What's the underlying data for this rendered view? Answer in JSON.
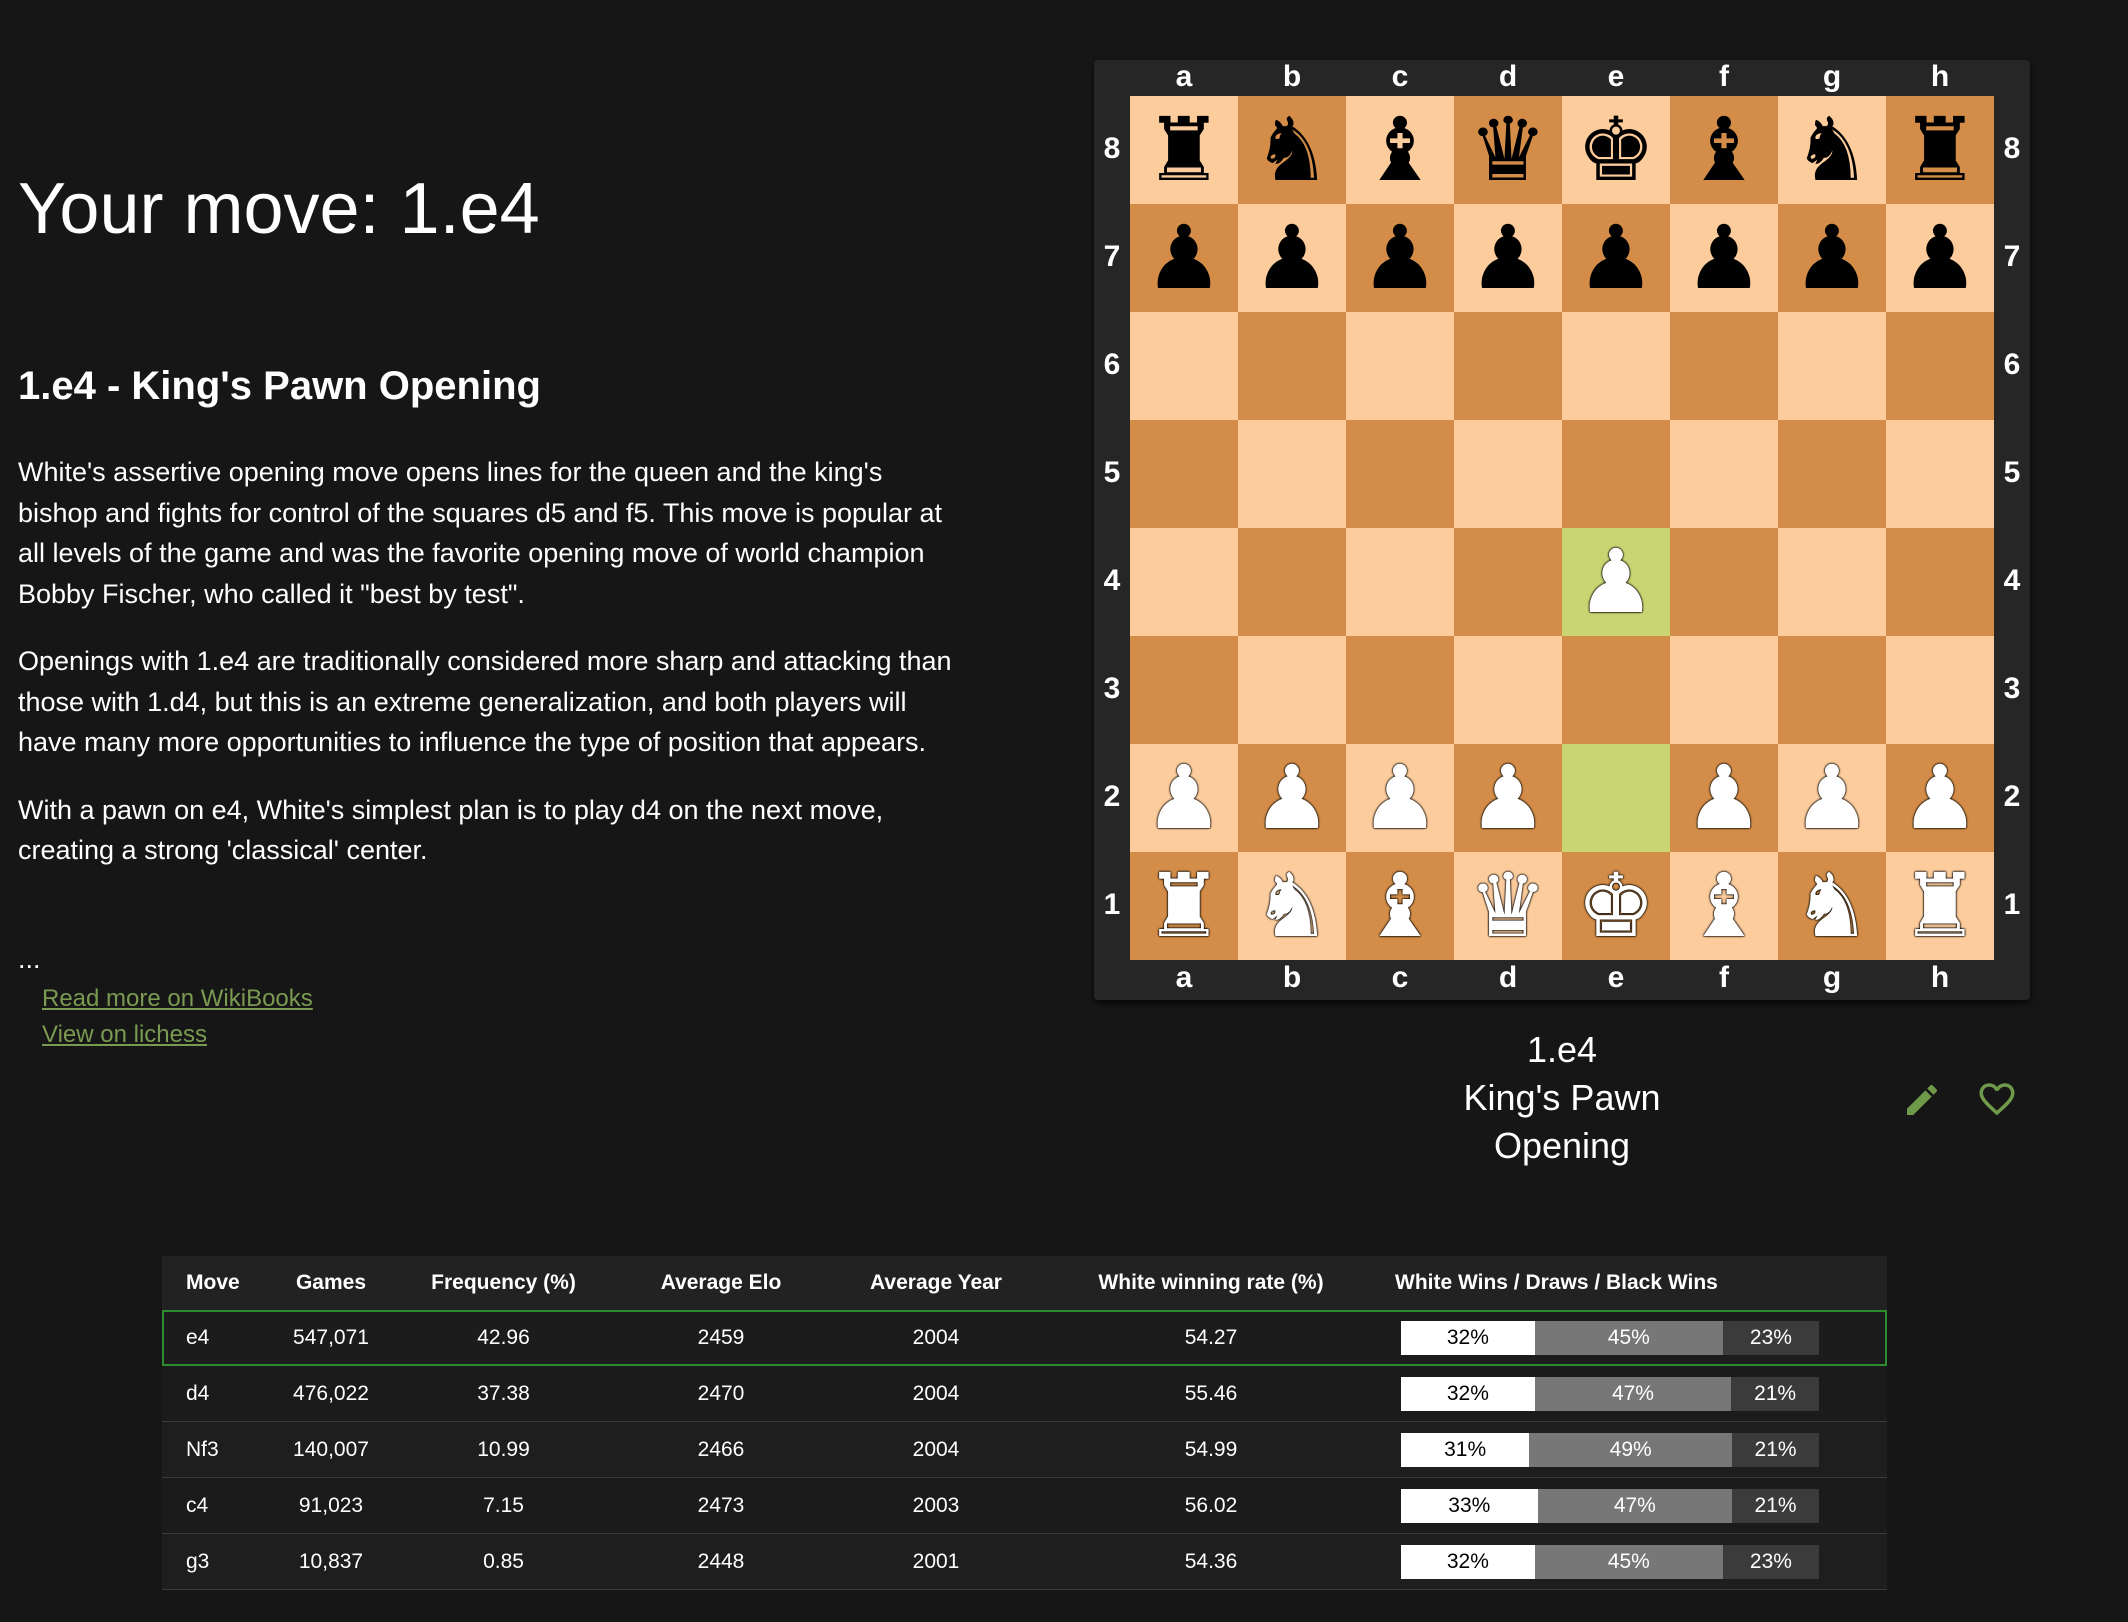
{
  "page": {
    "move_title": "Your move: 1.e4",
    "heading": "1.e4 - King's Pawn Opening",
    "paragraphs": [
      "White's assertive opening move opens lines for the queen and the king's bishop and fights for control of the squares d5 and f5. This move is popular at all levels of the game and was the favorite opening move of world champion Bobby Fischer, who called it \"best by test\".",
      "Openings with 1.e4 are traditionally considered more sharp and attacking than those with 1.d4, but this is an extreme generalization, and both players will have many more opportunities to influence the type of position that appears.",
      "With a pawn on e4, White's simplest plan is to play d4 on the next move, creating a strong 'classical' center."
    ],
    "ellipsis": "...",
    "link_wikibooks": "Read more on WikiBooks",
    "link_lichess": "View on lichess"
  },
  "board": {
    "files": [
      "a",
      "b",
      "c",
      "d",
      "e",
      "f",
      "g",
      "h"
    ],
    "ranks": [
      "8",
      "7",
      "6",
      "5",
      "4",
      "3",
      "2",
      "1"
    ],
    "position": [
      [
        "bR",
        "bN",
        "bB",
        "bQ",
        "bK",
        "bB",
        "bN",
        "bR"
      ],
      [
        "bP",
        "bP",
        "bP",
        "bP",
        "bP",
        "bP",
        "bP",
        "bP"
      ],
      [
        "",
        "",
        "",
        "",
        "",
        "",
        "",
        ""
      ],
      [
        "",
        "",
        "",
        "",
        "",
        "",
        "",
        ""
      ],
      [
        "",
        "",
        "",
        "",
        "wP",
        "",
        "",
        ""
      ],
      [
        "",
        "",
        "",
        "",
        "",
        "",
        "",
        ""
      ],
      [
        "wP",
        "wP",
        "wP",
        "wP",
        "",
        "wP",
        "wP",
        "wP"
      ],
      [
        "wR",
        "wN",
        "wB",
        "wQ",
        "wK",
        "wB",
        "wN",
        "wR"
      ]
    ],
    "highlight_squares": [
      "e4",
      "e2"
    ],
    "colors": {
      "light": "#fdcc9c",
      "dark": "#d38d48",
      "highlight": "#c9d473"
    }
  },
  "caption": {
    "move": "1.e4",
    "line2": "King's Pawn",
    "line3": "Opening"
  },
  "icons": {
    "edit": "pencil-icon",
    "favorite": "heart-outline-icon",
    "accent": "#6f9a4a"
  },
  "table": {
    "headers": [
      "Move",
      "Games",
      "Frequency (%)",
      "Average Elo",
      "Average Year",
      "White winning rate (%)",
      "White Wins / Draws / Black Wins"
    ],
    "rows": [
      {
        "move": "e4",
        "games": "547,071",
        "freq": "42.96",
        "elo": "2459",
        "year": "2004",
        "rate": "54.27",
        "w": "32%",
        "d": "45%",
        "l": "23%",
        "wv": 32,
        "dv": 45,
        "lv": 23
      },
      {
        "move": "d4",
        "games": "476,022",
        "freq": "37.38",
        "elo": "2470",
        "year": "2004",
        "rate": "55.46",
        "w": "32%",
        "d": "47%",
        "l": "21%",
        "wv": 32,
        "dv": 47,
        "lv": 21
      },
      {
        "move": "Nf3",
        "games": "140,007",
        "freq": "10.99",
        "elo": "2466",
        "year": "2004",
        "rate": "54.99",
        "w": "31%",
        "d": "49%",
        "l": "21%",
        "wv": 31,
        "dv": 49,
        "lv": 21
      },
      {
        "move": "c4",
        "games": "91,023",
        "freq": "7.15",
        "elo": "2473",
        "year": "2003",
        "rate": "56.02",
        "w": "33%",
        "d": "47%",
        "l": "21%",
        "wv": 33,
        "dv": 47,
        "lv": 21
      },
      {
        "move": "g3",
        "games": "10,837",
        "freq": "0.85",
        "elo": "2448",
        "year": "2001",
        "rate": "54.36",
        "w": "32%",
        "d": "45%",
        "l": "23%",
        "wv": 32,
        "dv": 45,
        "lv": 23
      }
    ],
    "selected_index": 0
  }
}
